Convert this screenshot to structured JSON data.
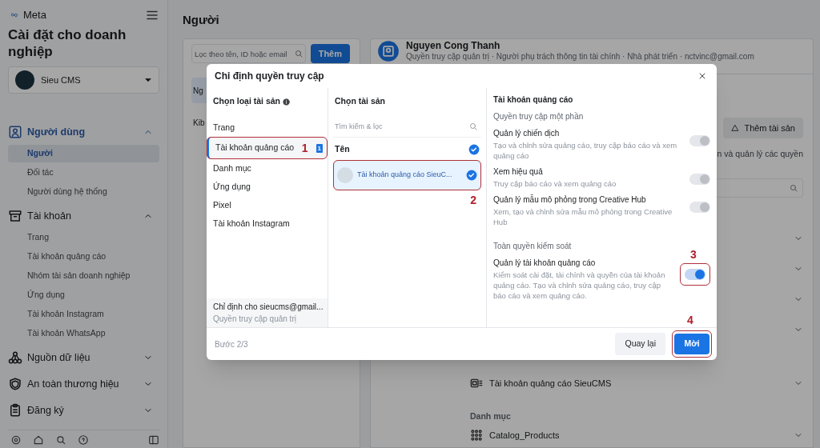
{
  "sidebar": {
    "brand": "Meta",
    "title": "Cài đặt cho doanh nghiệp",
    "account": "Sieu CMS",
    "sections": [
      {
        "label": "Người dùng",
        "selected": true,
        "expanded": true,
        "items": [
          {
            "label": "Người",
            "selected": true
          },
          {
            "label": "Đối tác",
            "selected": false
          },
          {
            "label": "Người dùng hệ thống",
            "selected": false
          }
        ]
      },
      {
        "label": "Tài khoản",
        "selected": false,
        "expanded": true,
        "items": [
          {
            "label": "Trang",
            "selected": false
          },
          {
            "label": "Tài khoản quảng cáo",
            "selected": false
          },
          {
            "label": "Nhóm tài sản doanh nghiệp",
            "selected": false
          },
          {
            "label": "Ứng dụng",
            "selected": false
          },
          {
            "label": "Tài khoản Instagram",
            "selected": false
          },
          {
            "label": "Tài khoản WhatsApp",
            "selected": false
          }
        ]
      },
      {
        "label": "Nguồn dữ liệu",
        "selected": false,
        "expanded": false
      },
      {
        "label": "An toàn thương hiệu",
        "selected": false,
        "expanded": false
      },
      {
        "label": "Đăng ký",
        "selected": false,
        "expanded": false
      }
    ]
  },
  "page_title": "Người",
  "people_panel": {
    "search_placeholder": "Lọc theo tên, ID hoặc email",
    "add_button": "Thêm",
    "list": [
      {
        "label": "Ng",
        "selected": true
      },
      {
        "label": "Kib",
        "selected": false
      }
    ]
  },
  "person_panel": {
    "name": "Nguyen Cong Thanh",
    "roles": "Quyền truy cập quản trị · Người phụ trách thông tin tài chính · Nhà phát triển · nctvinc@gmail.com",
    "add_asset_button": "Thêm tài sản",
    "description": "n và quản lý các quyền",
    "sections": [
      {
        "items": [
          "Tài khoản quảng cáo SieuCMS"
        ]
      },
      {
        "heading": "Danh mục",
        "items": [
          "Catalog_Products"
        ]
      }
    ]
  },
  "dialog": {
    "title": "Chỉ định quyền truy cập",
    "asset_types": {
      "heading": "Chọn loại tài sản",
      "items": [
        {
          "label": "Trang",
          "selected": false
        },
        {
          "label": "Tài khoản quảng cáo",
          "selected": true,
          "count": "1",
          "callout": "1"
        },
        {
          "label": "Danh mục",
          "selected": false
        },
        {
          "label": "Ứng dụng",
          "selected": false
        },
        {
          "label": "Pixel",
          "selected": false
        },
        {
          "label": "Tài khoản Instagram",
          "selected": false
        }
      ],
      "assignee": "Chỉ định cho sieucms@gmail...",
      "assignee_role": "Quyền truy cập quản trị"
    },
    "assets": {
      "heading": "Chọn tài sản",
      "search_placeholder": "Tìm kiếm & lọc",
      "column": "Tên",
      "all_checked": true,
      "rows": [
        {
          "name": "Tài khoản quảng cáo SieuC...",
          "checked": true,
          "selected": true,
          "callout": "2"
        }
      ]
    },
    "permissions": {
      "heading": "Tài khoản quảng cáo",
      "groups": [
        {
          "title": "Quyền truy cập một phần",
          "items": [
            {
              "name": "Quản lý chiến dịch",
              "description": "Tạo và chỉnh sửa quảng cáo, truy cập báo cáo và xem quảng cáo",
              "on": true,
              "disabled": true
            },
            {
              "name": "Xem hiệu quả",
              "description": "Truy cập báo cáo và xem quảng cáo",
              "on": true,
              "disabled": true
            },
            {
              "name": "Quản lý mẫu mô phỏng trong Creative Hub",
              "description": "Xem, tạo và chỉnh sửa mẫu mô phỏng trong Creative Hub",
              "on": true,
              "disabled": true
            }
          ]
        },
        {
          "title": "Toàn quyền kiểm soát",
          "items": [
            {
              "name": "Quản lý tài khoản quảng cáo",
              "description": "Kiểm soát cài đặt, tài chính và quyền của tài khoản quảng cáo. Tạo và chỉnh sửa quảng cáo, truy cập báo cáo và xem quảng cáo.",
              "on": true,
              "disabled": false,
              "callout": "3"
            }
          ]
        }
      ]
    },
    "step": "Bước 2/3",
    "back_button": "Quay lại",
    "next_button": {
      "label": "Mời",
      "callout": "4"
    }
  }
}
